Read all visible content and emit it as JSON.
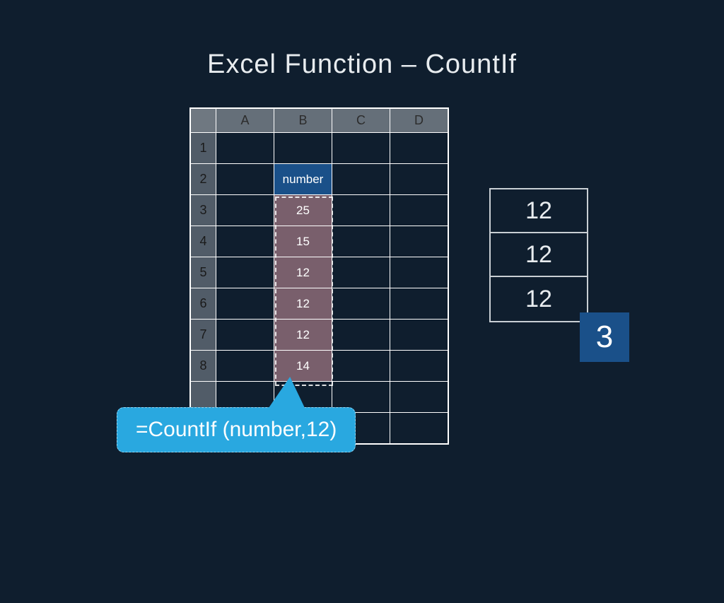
{
  "title": "Excel Function – CountIf",
  "columns": [
    "A",
    "B",
    "C",
    "D"
  ],
  "rows": [
    "1",
    "2",
    "3",
    "4",
    "5",
    "6",
    "7",
    "8",
    "",
    ""
  ],
  "cells": {
    "r2cB_label": "number",
    "r3cB": "25",
    "r4cB": "15",
    "r5cB": "12",
    "r6cB": "12",
    "r7cB": "12",
    "r8cB": "14"
  },
  "formula": "=CountIf (number,12)",
  "matches": [
    "12",
    "12",
    "12"
  ],
  "result": "3",
  "colors": {
    "background": "#0f1e2e",
    "accent_blue": "#1a5089",
    "callout_blue": "#29a8e0",
    "selection_fill": "rgba(210,150,160,0.55)"
  }
}
